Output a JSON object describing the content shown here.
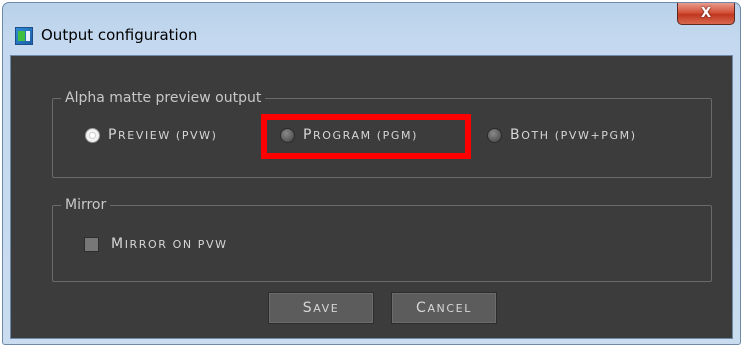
{
  "window": {
    "title": "Output configuration",
    "close_glyph": "X"
  },
  "alpha_group": {
    "legend": "Alpha matte preview output",
    "options": [
      {
        "first": "P",
        "rest": "review (PVW)",
        "checked": true
      },
      {
        "first": "P",
        "rest": "rogram (PGM)",
        "checked": false
      },
      {
        "first": "B",
        "rest": "oth (PVW+PGM)",
        "checked": false
      }
    ]
  },
  "mirror_group": {
    "legend": "Mirror",
    "checkbox": {
      "first": "M",
      "rest": "irror on PVW",
      "checked": false
    }
  },
  "buttons": {
    "save": {
      "first": "S",
      "rest": "ave"
    },
    "cancel": {
      "first": "C",
      "rest": "ancel"
    }
  },
  "colors": {
    "panel_bg": "#3c3c3c",
    "highlight": "#ff0000",
    "close_button": "#c8412a"
  }
}
